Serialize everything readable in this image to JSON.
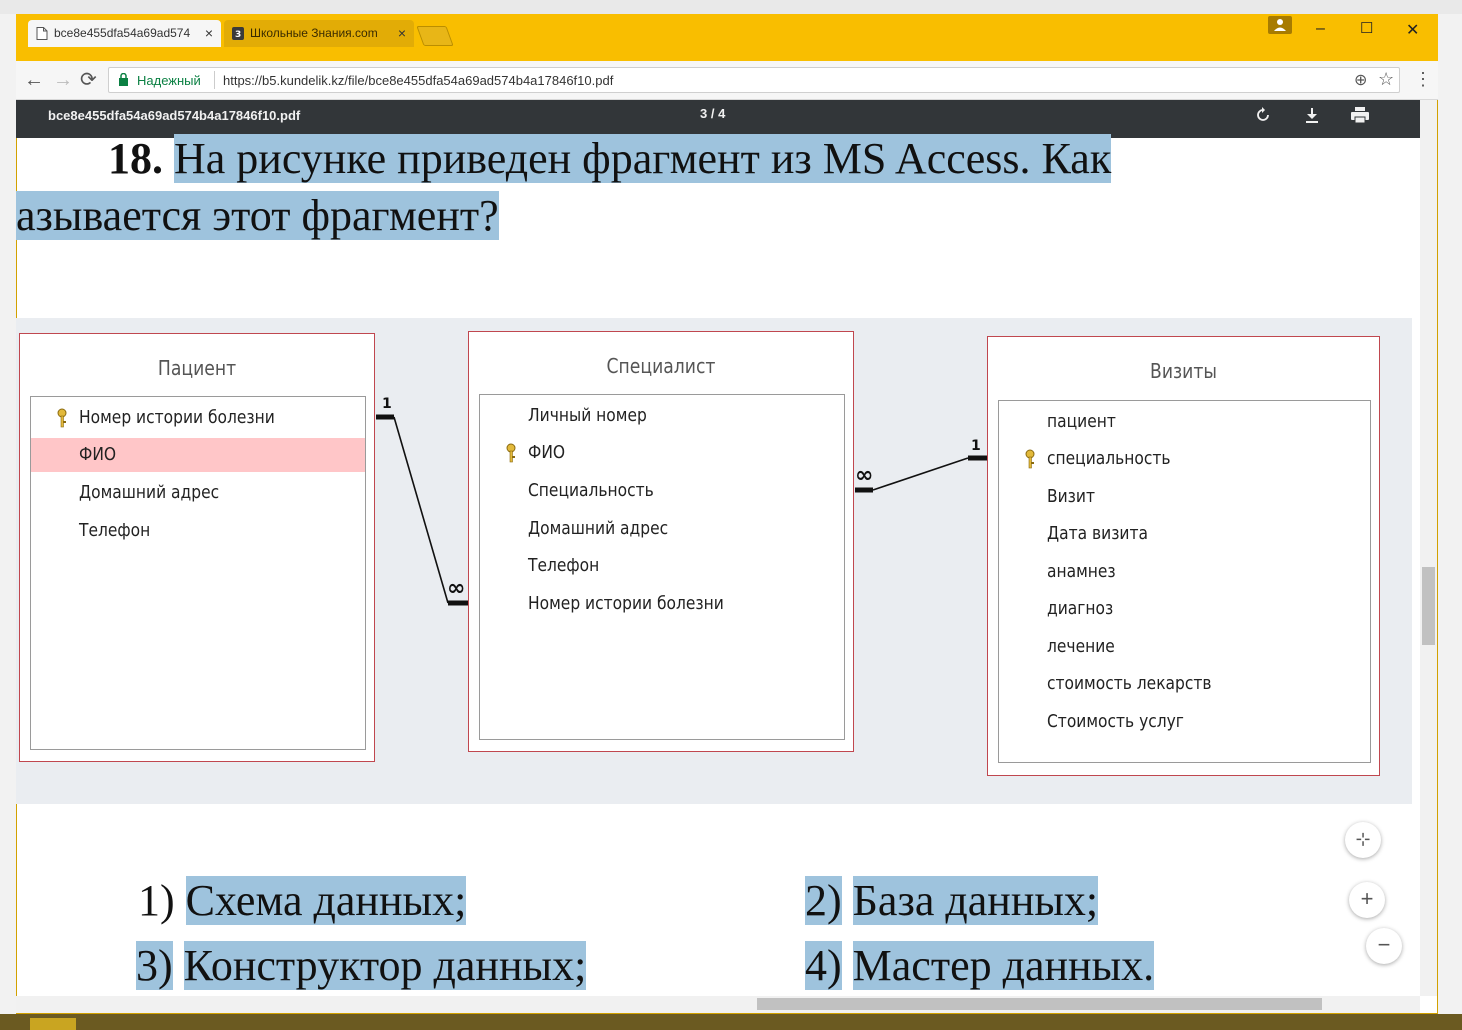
{
  "browser": {
    "tabs": [
      {
        "label": "bce8e455dfa54a69ad574",
        "close": "×"
      },
      {
        "label": "Школьные Знания.com",
        "close": "×"
      }
    ],
    "window_controls": {
      "minimize": "–",
      "maximize": "☐",
      "close": "✕"
    },
    "toolbar": {
      "back": "←",
      "forward": "→",
      "reload": "⟳",
      "secure_label": "Надежный",
      "url": "https://b5.kundelik.kz/file/bce8e455dfa54a69ad574b4a17846f10.pdf",
      "zoom_icon": "⊕",
      "star_icon": "☆",
      "menu_icon": "⋮"
    }
  },
  "pdf_viewer": {
    "filename": "bce8e455dfa54a69ad574b4a17846f10.pdf",
    "page_indicator": "3 / 4",
    "rotate_icon": "rotate-icon",
    "download_icon": "download-icon",
    "print_icon": "print-icon"
  },
  "document": {
    "question_number": "18.",
    "question_line1": "На рисунке приведен фрагмент из MS Access.  Как",
    "question_line2": "азывается этот фрагмент?",
    "tables": [
      {
        "title": "Пациент",
        "fields": [
          "Номер истории болезни",
          "ФИО",
          "Домашний адрес",
          "Телефон"
        ],
        "key_field": 0,
        "highlighted_field": 1
      },
      {
        "title": "Специалист",
        "fields": [
          "Личный номер",
          "ФИО",
          "Специальность",
          "Домашний адрес",
          "Телефон",
          "Номер истории болезни"
        ],
        "key_field": 1
      },
      {
        "title": "Визиты",
        "fields": [
          "пациент",
          "специальность",
          "Визит",
          "Дата визита",
          "анамнез",
          "диагноз",
          "лечение",
          "стоимость лекарств",
          "Стоимость услуг"
        ],
        "key_field": 1
      }
    ],
    "relationships": [
      {
        "one": "1",
        "many": "∞"
      },
      {
        "one": "1",
        "many": "∞"
      }
    ],
    "answers": [
      {
        "number": "1)",
        "text": "Схема данных;"
      },
      {
        "number": "2)",
        "text": "База данных;"
      },
      {
        "number": "3)",
        "text": "Конструктор данных;"
      },
      {
        "number": "4)",
        "text": "Мастер данных."
      }
    ]
  },
  "zoom_controls": {
    "fit": "⊹",
    "zoom_in": "+",
    "zoom_out": "−"
  }
}
